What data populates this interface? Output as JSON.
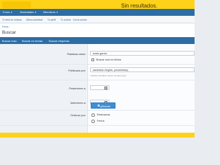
{
  "header": {
    "title": "Sin resultados.",
    "accent_color": "#ffd21a",
    "nav_color": "#2d6da5"
  },
  "nav": {
    "tabs": [
      {
        "label": "Foros",
        "icon": "chevron-down-icon"
      },
      {
        "label": "Novedades",
        "icon": "chevron-down-icon"
      },
      {
        "label": "Miembros",
        "icon": "chevron-down-icon"
      }
    ]
  },
  "subnav": {
    "links": [
      "Tu feed de noticias",
      "Último actividad",
      "Tu perfil",
      "Tu cuenta",
      "Cerrar sesión"
    ]
  },
  "breadcrumb": {
    "items": [
      "Foros"
    ]
  },
  "page": {
    "title": "Buscar"
  },
  "search_tabs": {
    "tabs": [
      "Buscar todo",
      "Buscar en temas",
      "Buscar etiquetas"
    ]
  },
  "form": {
    "keywords": {
      "label": "Palabras clave:",
      "value": "koldo garcia",
      "titles_only_label": "Buscar solo en títulos"
    },
    "posted_by": {
      "label": "Publicado por:",
      "value": "sandokan begins, yonosésdoy,",
      "hint": "Puedes introducir varios nombres aquí."
    },
    "newer_than": {
      "label": "Posteriores a:"
    },
    "older_than": {
      "label": "Anteriores a:"
    },
    "order": {
      "label": "Ordenar por:",
      "options": [
        "Relevancia",
        "Fecha"
      ]
    },
    "submit_label": "Buscar"
  }
}
